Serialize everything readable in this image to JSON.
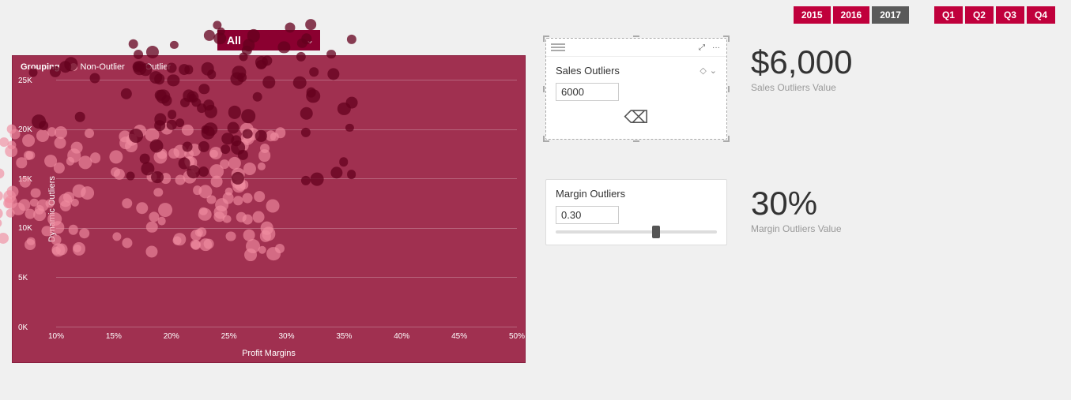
{
  "topBar": {
    "years": [
      {
        "label": "2015",
        "active": false
      },
      {
        "label": "2016",
        "active": false
      },
      {
        "label": "2017",
        "active": true
      }
    ],
    "quarters": [
      {
        "label": "Q1"
      },
      {
        "label": "Q2"
      },
      {
        "label": "Q3"
      },
      {
        "label": "Q4"
      }
    ]
  },
  "dropdown": {
    "value": "All",
    "options": [
      "All",
      "Non-Outlier",
      "Outlier"
    ]
  },
  "chart": {
    "title": "Grouping",
    "legend": {
      "groupingLabel": "Grouping",
      "nonOutlierLabel": "Non-Outlier",
      "outlierLabel": "Outlier"
    },
    "yAxisLabel": "Dynamic Outliers",
    "xAxisLabel": "Profit Margins",
    "yTicks": [
      "25K",
      "20K",
      "15K",
      "10K",
      "5K",
      "0K"
    ],
    "xTicks": [
      "10%",
      "15%",
      "20%",
      "25%",
      "30%",
      "35%",
      "40%",
      "45%",
      "50%"
    ]
  },
  "salesCard": {
    "title": "Sales Outliers",
    "inputValue": "6000",
    "icons": {
      "menu": "≡",
      "expand": "⤢",
      "more": "···",
      "diamond": "◇",
      "chevron": "∨"
    }
  },
  "salesStat": {
    "value": "$6,000",
    "label": "Sales Outliers Value"
  },
  "marginCard": {
    "title": "Margin Outliers",
    "inputValue": "0.30",
    "sliderPosition": "60%"
  },
  "marginStat": {
    "value": "30%",
    "label": "Margin Outliers Value"
  }
}
